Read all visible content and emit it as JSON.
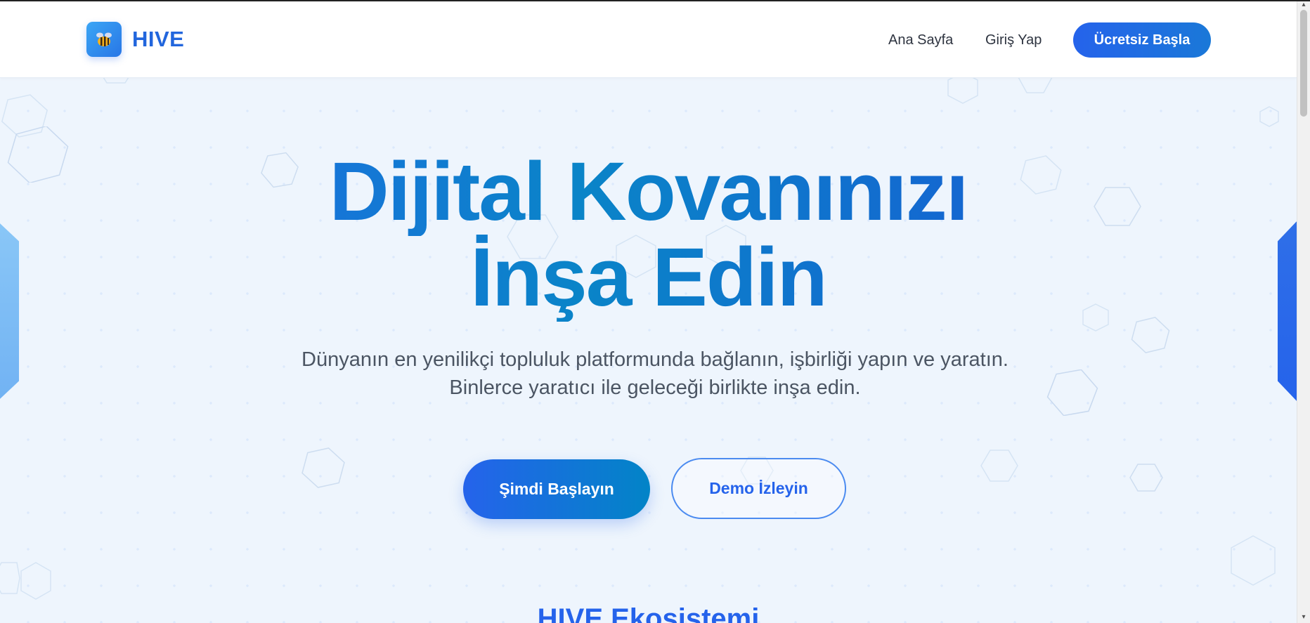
{
  "header": {
    "brand": "HIVE",
    "logo_icon": "bee-icon",
    "nav": {
      "home": "Ana Sayfa",
      "login": "Giriş Yap",
      "cta": "Ücretsiz Başla"
    }
  },
  "hero": {
    "title_line1": "Dijital Kovanınızı",
    "title_line2": "İnşa Edin",
    "subtitle": "Dünyanın en yenilikçi topluluk platformunda bağlanın, işbirliği yapın ve yaratın. Binlerce yaratıcı ile geleceği birlikte inşa edin.",
    "primary_button": "Şimdi Başlayın",
    "secondary_button": "Demo İzleyin"
  },
  "next_section": {
    "title": "HIVE Ekosistemi"
  },
  "colors": {
    "accent": "#2563eb",
    "accent_secondary": "#0284c7",
    "background": "#eef5fd",
    "text_muted": "#4b5563"
  }
}
